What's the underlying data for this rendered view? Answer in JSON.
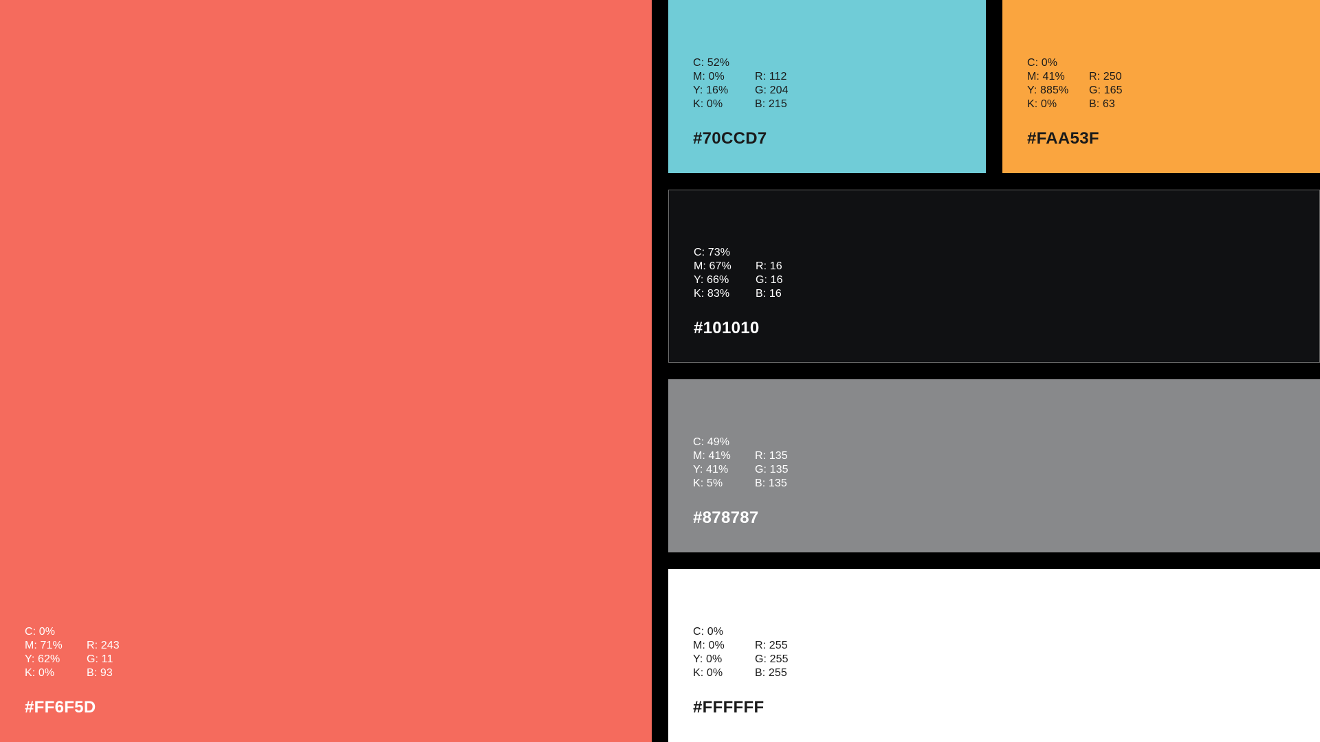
{
  "swatches": {
    "coral": {
      "fill": "#F56B5D",
      "text_color": "#FFFFFF",
      "c": "C: 0%",
      "m": "M: 71%",
      "y": "Y: 62%",
      "k": "K: 0%",
      "r": "",
      "r2": "R: 243",
      "g": "G: 11",
      "b": "B: 93",
      "hex": "#FF6F5D"
    },
    "cyan": {
      "fill": "#70CCD7",
      "text_color": "#1a1a1a",
      "c": "C: 52%",
      "m": "M: 0%",
      "y": "Y: 16%",
      "k": "K: 0%",
      "r": "",
      "r2": "R: 112",
      "g": "G: 204",
      "b": "B: 215",
      "hex": "#70CCD7"
    },
    "orange": {
      "fill": "#FAA53F",
      "text_color": "#1a1a1a",
      "c": "C: 0%",
      "m": "M: 41%",
      "y": "Y: 885%",
      "k": "K: 0%",
      "r": "",
      "r2": "R: 250",
      "g": "G: 165",
      "b": "B: 63",
      "hex": "#FAA53F"
    },
    "black": {
      "fill": "#101113",
      "text_color": "#FFFFFF",
      "c": "C: 73%",
      "m": "M: 67%",
      "y": "Y: 66%",
      "k": "K: 83%",
      "r": "",
      "r2": "R: 16",
      "g": "G: 16",
      "b": "B: 16",
      "hex": "#101010"
    },
    "gray": {
      "fill": "#88898B",
      "text_color": "#FFFFFF",
      "c": "C: 49%",
      "m": "M: 41%",
      "y": "Y: 41%",
      "k": "K: 5%",
      "r": "",
      "r2": "R: 135",
      "g": "G: 135",
      "b": "B: 135",
      "hex": "#878787"
    },
    "white": {
      "fill": "#FFFFFF",
      "text_color": "#1a1a1a",
      "c": "C: 0%",
      "m": "M: 0%",
      "y": "Y: 0%",
      "k": "K: 0%",
      "r": "",
      "r2": "R: 255",
      "g": "G: 255",
      "b": "B: 255",
      "hex": "#FFFFFF"
    }
  }
}
